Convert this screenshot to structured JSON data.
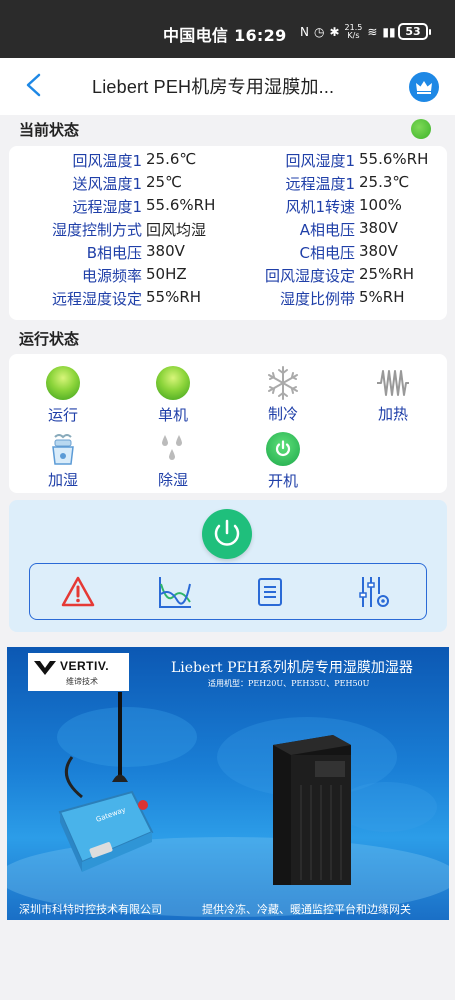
{
  "statusbar": {
    "carrier_time": "中国电信 16:29",
    "net_speed_top": "21.5",
    "net_speed_bottom": "K/s",
    "battery": "53"
  },
  "header": {
    "title": "Liebert PEH机房专用湿膜加..."
  },
  "current_status": {
    "title": "当前状态",
    "indicator_color": "#3db32a",
    "rows": [
      {
        "left_label": "回风温度1",
        "left_value": "25.6℃",
        "right_label": "回风湿度1",
        "right_value": "55.6%RH"
      },
      {
        "left_label": "送风温度1",
        "left_value": "25℃",
        "right_label": "远程温度1",
        "right_value": "25.3℃"
      },
      {
        "left_label": "远程湿度1",
        "left_value": "55.6%RH",
        "right_label": "风机1转速",
        "right_value": "100%"
      },
      {
        "left_label": "湿度控制方式",
        "left_value": "回风均湿",
        "right_label": "A相电压",
        "right_value": "380V"
      },
      {
        "left_label": "B相电压",
        "left_value": "380V",
        "right_label": "C相电压",
        "right_value": "380V"
      },
      {
        "left_label": "电源频率",
        "left_value": "50HZ",
        "right_label": "回风湿度设定",
        "right_value": "25%RH"
      },
      {
        "left_label": "远程湿度设定",
        "left_value": "55%RH",
        "right_label": "湿度比例带",
        "right_value": "5%RH"
      }
    ]
  },
  "run_status": {
    "title": "运行状态",
    "items": [
      {
        "label": "运行",
        "icon": "green-ball-icon"
      },
      {
        "label": "单机",
        "icon": "green-ball-icon"
      },
      {
        "label": "制冷",
        "icon": "snowflake-icon"
      },
      {
        "label": "加热",
        "icon": "heater-icon"
      },
      {
        "label": "加湿",
        "icon": "humidifier-icon"
      },
      {
        "label": "除湿",
        "icon": "droplets-icon"
      },
      {
        "label": "开机",
        "icon": "power-on-icon"
      }
    ]
  },
  "controls": {
    "power_icon": "power-icon",
    "tools": [
      "alarm-icon",
      "curve-chart-icon",
      "list-icon",
      "settings-sliders-icon"
    ]
  },
  "banner": {
    "brand": "VERTIV.",
    "brand_sub": "维谛技术",
    "title": "Liebert PEH系列机房专用湿膜加湿器",
    "models": "适用机型：PEH20U、PEH35U、PEH50U",
    "footer_left": "深圳市科特时控技术有限公司",
    "footer_right": "提供冷冻、冷藏、暖通监控平台和边缘网关",
    "device_label": "Gateway"
  },
  "colors": {
    "label_blue": "#1f3fa8",
    "accent_blue": "#1e88e5",
    "power_green": "#1fbf7c"
  }
}
